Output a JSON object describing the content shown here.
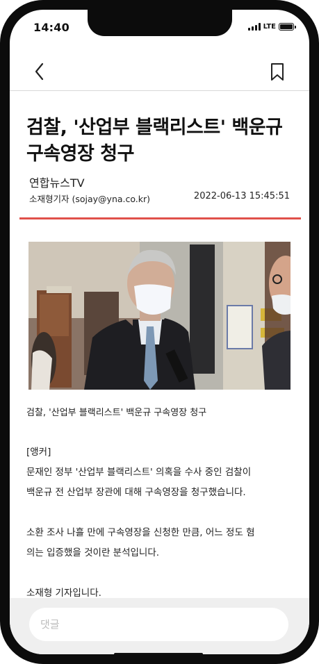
{
  "status_bar": {
    "time": "14:40",
    "network": "LTE"
  },
  "article": {
    "headline": "검찰, '산업부 블랙리스트' 백운규 구속영장 청구",
    "source": "연합뉴스TV",
    "reporter": "소재형기자 (sojay@yna.co.kr)",
    "datetime": "2022-06-13   15:45:51",
    "photo_caption": "검찰, '산업부 블랙리스트' 백운규 구속영장 청구",
    "body": {
      "tag": "[앵커]",
      "p1_line1": "문재인 정부 '산업부 블랙리스트' 의혹을 수사 중인 검찰이",
      "p1_line2": "백운규 전 산업부 장관에 대해 구속영장을 청구했습니다.",
      "p2_line1": "소환 조사 나흘 만에 구속영장을 신청한 만큼, 어느 정도 혐",
      "p2_line2": "의는 입증했을 것이란 분석입니다.",
      "p3_line1": "소재형 기자입니다."
    }
  },
  "comment": {
    "placeholder": "댓글"
  },
  "colors": {
    "accent": "#e0504a",
    "frame": "#0c0c0c",
    "comment_bg": "#efefef"
  },
  "icons": [
    "back-chevron-icon",
    "bookmark-icon",
    "signal-icon",
    "battery-icon"
  ]
}
